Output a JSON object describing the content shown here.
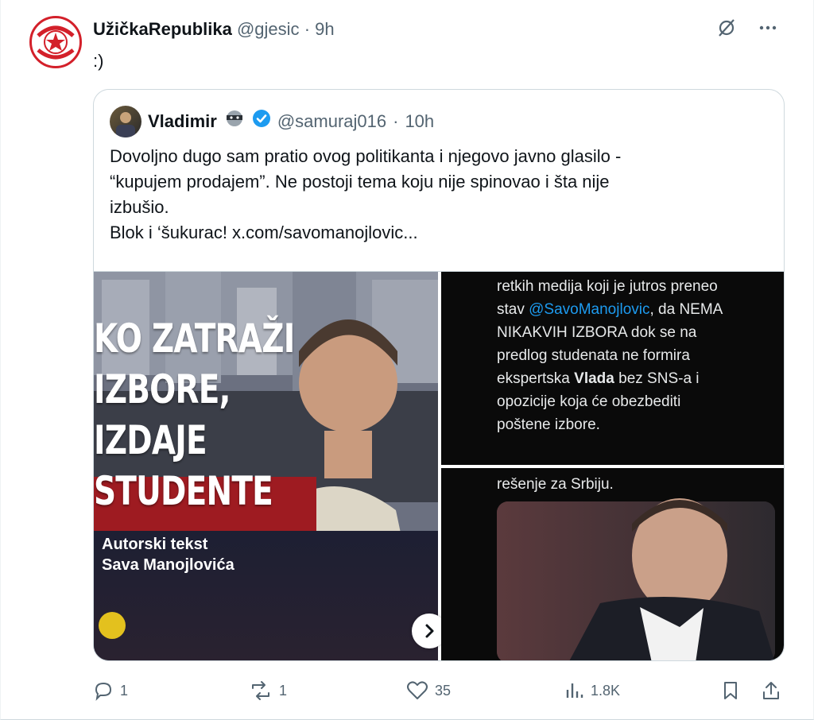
{
  "post": {
    "display_name": "UžičkaRepublika",
    "handle": "@gjesic",
    "separator": "·",
    "time": "9h",
    "text": ":)"
  },
  "quoted": {
    "display_name": "Vladimir",
    "handle": "@samuraj016",
    "separator": "·",
    "time": "10h",
    "lines": [
      "Dovoljno dugo sam pratio ovog politikanta i njegovo javno glasilo -",
      "“kupujem prodajem”. Ne postoji tema koju nije spinovao i šta nije",
      "izbušio.",
      "Blok i ‘šukurac!  x.com/savomanojlovic..."
    ],
    "media_left": {
      "headline_lines": [
        "KO ZATRAŽI",
        "IZBORE,",
        "IZDAJE",
        "STUDENTE"
      ],
      "author_lines": [
        "Autorski tekst",
        "Sava Manojlovića"
      ]
    },
    "media_right_top": {
      "line1": "retkih medija koji je jutros preneo",
      "line2_pre": "stav ",
      "line2_link": "@SavoManojlovic",
      "line2_post": ", da NEMA",
      "line3": "NIKAKVIH IZBORA dok se na",
      "line4": "predlog studenata ne formira",
      "line5_pre": "ekspertska ",
      "line5_bold": "Vlada",
      "line5_post": " bez SNS-a i",
      "line6": "opozicije koja će obezbediti",
      "line7": "poštene izbore."
    },
    "media_right_bottom": {
      "line1": "rešenje za Srbiju."
    }
  },
  "actions": {
    "replies": "1",
    "reposts": "1",
    "likes": "35",
    "views": "1.8K"
  },
  "colors": {
    "accent": "#1d9bf0",
    "muted": "#536471",
    "verified": "#1d9bf0",
    "brand_red": "#d3202a"
  },
  "icons": [
    "grok-icon",
    "more-icon",
    "reply-icon",
    "repost-icon",
    "like-icon",
    "views-icon",
    "bookmark-icon",
    "share-icon",
    "verified-badge-icon",
    "chevron-right-icon"
  ]
}
